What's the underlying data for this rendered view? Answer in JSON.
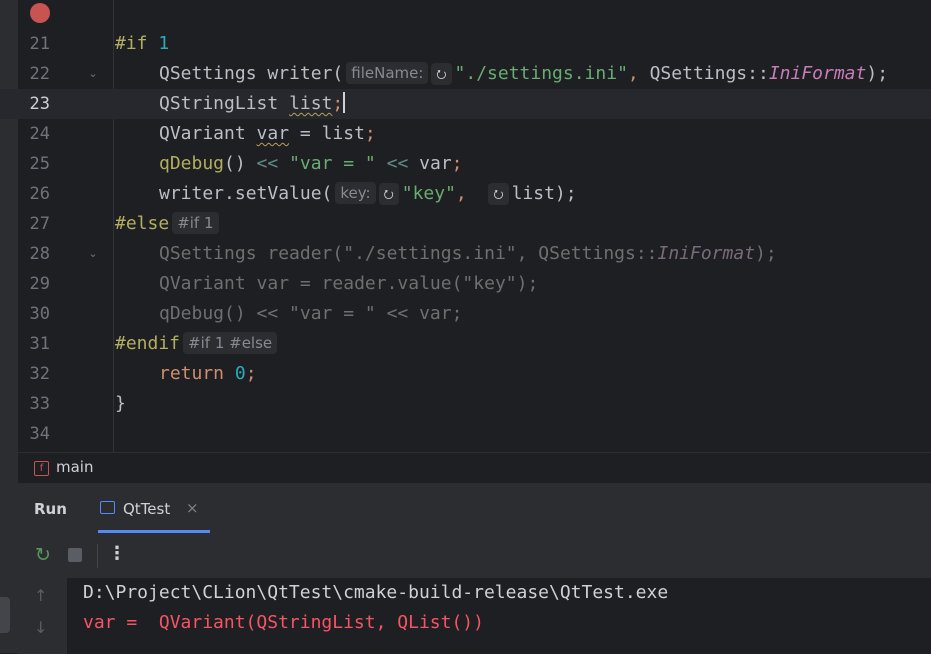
{
  "editor": {
    "lines": [
      {
        "num": "21"
      },
      {
        "num": "22"
      },
      {
        "num": "23"
      },
      {
        "num": "24"
      },
      {
        "num": "25"
      },
      {
        "num": "26"
      },
      {
        "num": "27"
      },
      {
        "num": "28"
      },
      {
        "num": "29"
      },
      {
        "num": "30"
      },
      {
        "num": "31"
      },
      {
        "num": "32"
      },
      {
        "num": "33"
      },
      {
        "num": "34"
      }
    ],
    "tokens": {
      "if1_kw": "#if",
      "if1_num": "1",
      "l22_type": "QSettings",
      "l22_var": " writer(",
      "l22_hint": "fileName:",
      "l22_icon": "⭮",
      "l22_str": "\"./settings.ini\"",
      "l22_comma": ", ",
      "l22_scope": "QSettings::",
      "l22_enum": "IniFormat",
      "l22_end": ");",
      "l23_type": "QStringList",
      "l23_var": "list",
      "l23_semi": ";",
      "l24_type": "QVariant",
      "l24_var": "var",
      "l24_rest": " = list",
      "l24_semi": ";",
      "l25_fn": "qDebug",
      "l25_paren": "()",
      "l25_op1": " << ",
      "l25_str": "\"var = \"",
      "l25_op2": " << ",
      "l25_var": "var",
      "l25_semi": ";",
      "l26_call": "writer.setValue(",
      "l26_hint": "key:",
      "l26_icon1": "⭮",
      "l26_str": "\"key\"",
      "l26_comma": ",",
      "l26_icon2": "⭮",
      "l26_end": "list);",
      "else_kw": "#else",
      "else_hint": "#if 1",
      "l28_text": "QSettings reader(\"./settings.ini\", QSettings::",
      "l28_enum": "IniFormat",
      "l28_end": ");",
      "l29_text": "QVariant var = reader.value(\"key\");",
      "l30_text": "qDebug() << \"var = \" << var;",
      "endif_kw": "#endif",
      "endif_hint": "#if 1 #else",
      "l32_kw": "return",
      "l32_num": "0",
      "l32_semi": ";",
      "l33_brace": "}"
    }
  },
  "breadcrumb": {
    "icon": "f",
    "label": "main"
  },
  "run_panel": {
    "title": "Run",
    "tab_label": "QtTest",
    "tab_close": "×",
    "toolbar_more": "⋮",
    "rerun_icon": "↻",
    "console": {
      "line1": "D:\\Project\\CLion\\QtTest\\cmake-build-release\\QtTest.exe",
      "line2": "var =  QVariant(QStringList, QList())"
    },
    "scroll_up": "↑",
    "scroll_down": "↓"
  },
  "colors": {
    "background": "#1e1f22",
    "panel": "#2b2d30",
    "accent": "#548af7",
    "error": "#f75464",
    "breakpoint": "#c75450"
  }
}
